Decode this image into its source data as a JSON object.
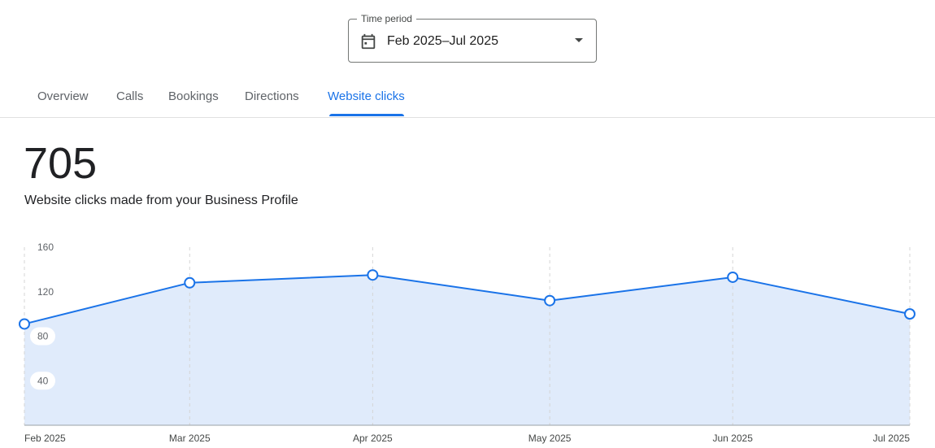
{
  "time_period": {
    "legend": "Time period",
    "value": "Feb 2025–Jul 2025",
    "icon": "calendar-icon"
  },
  "tabs": [
    {
      "label": "Overview",
      "active": false
    },
    {
      "label": "Calls",
      "active": false
    },
    {
      "label": "Bookings",
      "active": false
    },
    {
      "label": "Directions",
      "active": false
    },
    {
      "label": "Website clicks",
      "active": true
    }
  ],
  "metric": {
    "total": "705",
    "description": "Website clicks made from your Business Profile"
  },
  "colors": {
    "accent": "#1a73e8",
    "area_fill": "#e0ebfb",
    "grid": "#d5d5d5"
  },
  "chart_data": {
    "type": "area",
    "categories": [
      "Feb 2025",
      "Mar 2025",
      "Apr 2025",
      "May 2025",
      "Jun 2025",
      "Jul 2025"
    ],
    "x_days": [
      1,
      29,
      60,
      90,
      121,
      151
    ],
    "values": [
      91,
      128,
      135,
      112,
      133,
      100
    ],
    "yticks": [
      40,
      80,
      120,
      160
    ],
    "ylim": [
      0,
      160
    ],
    "grid": "vertical dashed",
    "markers": "hollow circles",
    "xlabel": "",
    "ylabel": ""
  }
}
